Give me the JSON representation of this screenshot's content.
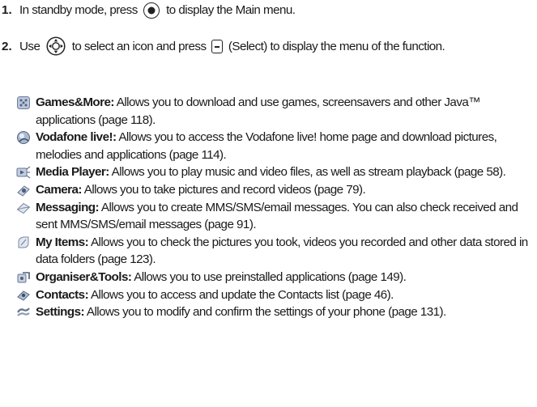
{
  "steps": [
    {
      "number": "1.",
      "text_before": "In standby mode, press",
      "key_icon": "center-key-icon",
      "text_after": "to display the Main menu."
    },
    {
      "number": "2.",
      "text_before": "Use",
      "key_icon": "navigation-key-icon",
      "text_middle": "to select an icon and press",
      "key_icon_2": "soft-key-icon",
      "text_after": "(Select) to display the menu of the function."
    }
  ],
  "menu_items": [
    {
      "icon": "games-icon",
      "name": "Games&More:",
      "text": "Allows you to download and use games, screensavers and other Java™ applications (page 118)."
    },
    {
      "icon": "vodafone-live-icon",
      "name": "Vodafone live!:",
      "text": "Allows you to access the Vodafone live! home page and download pictures, melodies and applications (page 114)."
    },
    {
      "icon": "media-player-icon",
      "name": "Media Player:",
      "text": "Allows you to play music and video files, as well as stream playback (page 58)."
    },
    {
      "icon": "camera-icon",
      "name": "Camera:",
      "text": "Allows you to take pictures and record videos (page 79)."
    },
    {
      "icon": "messaging-icon",
      "name": "Messaging:",
      "text": "Allows you to create MMS/SMS/email messages. You can also check received and sent MMS/SMS/email messages (page 91)."
    },
    {
      "icon": "my-items-icon",
      "name": "My Items:",
      "text": "Allows you to check the pictures you took, videos you recorded and other data stored in data folders (page 123)."
    },
    {
      "icon": "organiser-tools-icon",
      "name": "Organiser&Tools:",
      "text": "Allows you to use preinstalled applications (page 149)."
    },
    {
      "icon": "contacts-icon",
      "name": "Contacts:",
      "text": "Allows you to access and update the Contacts list (page 46)."
    },
    {
      "icon": "settings-icon",
      "name": "Settings:",
      "text": "Allows you to modify and confirm the settings of your phone (page 131)."
    }
  ]
}
